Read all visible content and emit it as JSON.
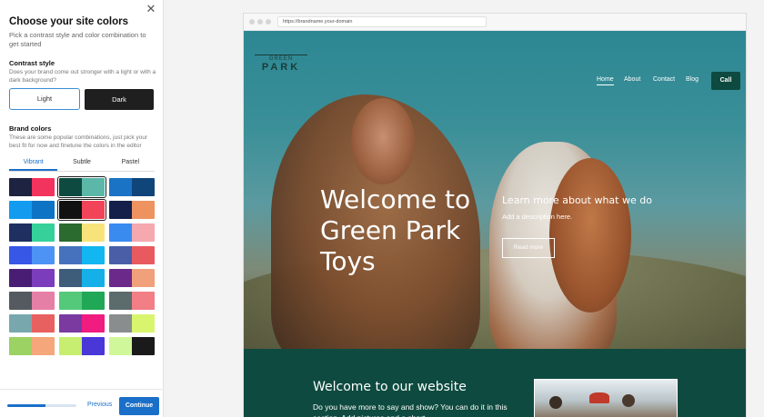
{
  "panel": {
    "title": "Choose your site colors",
    "subtitle": "Pick a contrast style and color combination to get started",
    "contrast": {
      "title": "Contrast style",
      "subtitle": "Does your brand come out stronger with a light or with a dark background?",
      "light_label": "Light",
      "dark_label": "Dark"
    },
    "brand": {
      "title": "Brand colors",
      "subtitle": "These are some popular combinations, just pick your best fit for now and finetune the colors in the editor",
      "tabs": [
        "Vibrant",
        "Subtle",
        "Pastel"
      ],
      "active_tab": "Vibrant",
      "selected_swatch": "2-1",
      "swatches": [
        [
          [
            "#1d2340",
            "#f2335d"
          ],
          [
            "#0e4a3f",
            "#5bb7a8"
          ],
          [
            "#1a73c4",
            "#10457a"
          ]
        ],
        [
          [
            "#139bf0",
            "#0d74c5"
          ],
          [
            "#111111",
            "#f24458"
          ],
          [
            "#14204a",
            "#ee9360"
          ]
        ],
        [
          [
            "#1e2f60",
            "#36d19a"
          ],
          [
            "#2b6b2f",
            "#f8e37a"
          ],
          [
            "#3a8bf0",
            "#f5a8ae"
          ]
        ],
        [
          [
            "#3757e6",
            "#4d93f5"
          ],
          [
            "#4672bd",
            "#12b6f0"
          ],
          [
            "#4a5ea8",
            "#e85a5f"
          ]
        ],
        [
          [
            "#4a1d75",
            "#7c3dbd"
          ],
          [
            "#3e5d7b",
            "#16b0e8"
          ],
          [
            "#6b2a8a",
            "#f0a07a"
          ]
        ],
        [
          [
            "#555a60",
            "#e67fa6"
          ],
          [
            "#55c97a",
            "#20a856"
          ],
          [
            "#5c6b6b",
            "#f27e86"
          ]
        ],
        [
          [
            "#78a8ad",
            "#e86060"
          ],
          [
            "#7a3aa0",
            "#f01c80"
          ],
          [
            "#8a8d8e",
            "#d9f56d"
          ]
        ],
        [
          [
            "#9bd263",
            "#f5a67a"
          ],
          [
            "#c7ee70",
            "#4a37d8"
          ],
          [
            "#d0f79a",
            "#1a1a1a"
          ]
        ]
      ]
    },
    "footer": {
      "progress": 0.55,
      "previous_label": "Previous",
      "continue_label": "Continue"
    }
  },
  "browser": {
    "url": "https://brandname.your-domain",
    "logo_top": "GREEN",
    "logo_bottom": "PARK",
    "nav": [
      "Home",
      "About",
      "Contact",
      "Blog"
    ],
    "active_nav": "Home",
    "call_label": "Call",
    "hero": {
      "title": "Welcome to Green Park Toys",
      "right_title": "Learn more about what we do",
      "right_desc": "Add a description here.",
      "button_label": "Read more"
    },
    "section": {
      "title": "Welcome to our website",
      "text": "Do you have more to say and show? You can do it in this section. Add pictures and a short"
    },
    "colors": {
      "accent": "#1a6fc8",
      "brand_dark": "#0e4a3f",
      "brand_light": "#5bb7a8"
    }
  }
}
